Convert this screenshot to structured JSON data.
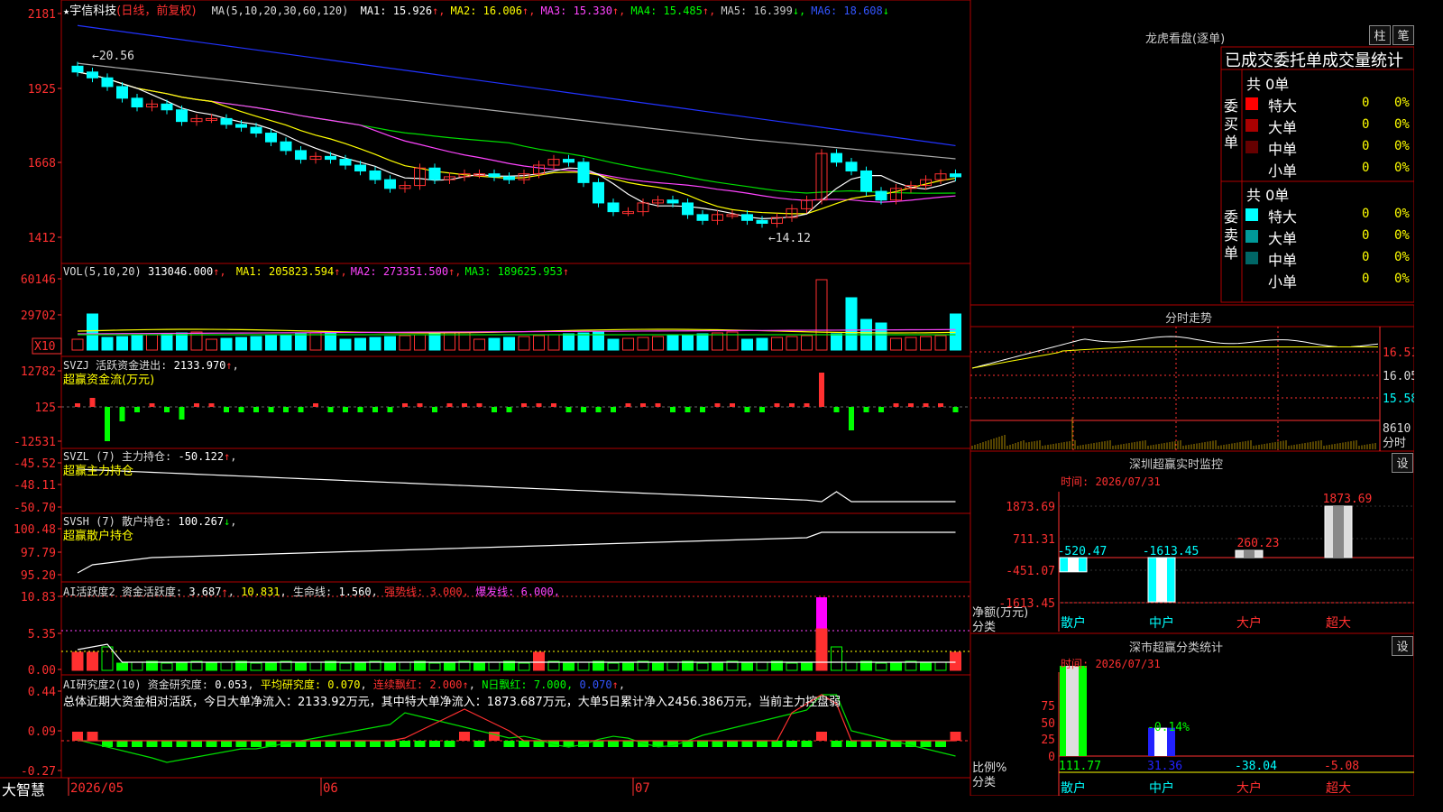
{
  "app": {
    "brand": "大智慧",
    "stock_name": "宇信科技",
    "mode": "(日线，前复权)"
  },
  "kline": {
    "ma_header": "MA(5,10,20,30,60,120)",
    "ma": [
      {
        "label": "MA1:",
        "value": "15.926",
        "arrow": "↑",
        "color": "#ffffff"
      },
      {
        "label": "MA2:",
        "value": "16.006",
        "arrow": "↑",
        "color": "#ffff00"
      },
      {
        "label": "MA3:",
        "value": "15.330",
        "arrow": "↑",
        "color": "#ff44ff"
      },
      {
        "label": "MA4:",
        "value": "15.485",
        "arrow": "↑",
        "color": "#00ff00"
      },
      {
        "label": "MA5:",
        "value": "16.399",
        "arrow": "↓",
        "color": "#c8c8c8"
      },
      {
        "label": "MA6:",
        "value": "18.608",
        "arrow": "↓",
        "color": "#3355ff"
      }
    ],
    "y_ticks": [
      "2181",
      "1925",
      "1668",
      "1412"
    ],
    "high_note": "←20.56",
    "low_note": "←14.12"
  },
  "vol": {
    "header": "VOL(5,10,20)",
    "value": "313046.000",
    "ma": [
      {
        "label": "MA1:",
        "value": "205823.594",
        "color": "#ffff00"
      },
      {
        "label": "MA2:",
        "value": "273351.500",
        "color": "#ff44ff"
      },
      {
        "label": "MA3:",
        "value": "189625.953",
        "color": "#00ff00"
      }
    ],
    "y_ticks": [
      "60146",
      "29702"
    ],
    "unit": "X10"
  },
  "svzj": {
    "header": "SVZJ  活跃资金进出:",
    "value": "2133.970",
    "sub": "超赢资金流(万元)",
    "y_ticks": [
      "12782",
      "125",
      "-12531"
    ]
  },
  "svzl": {
    "header": "SVZL (7) 主力持仓:",
    "value": "-50.122",
    "sub": "超赢主力持仓",
    "y_ticks": [
      "-45.52",
      "-48.11",
      "-50.70"
    ]
  },
  "svsh": {
    "header": "SVSH (7) 散户持仓:",
    "value": "100.267",
    "sub": "超赢散户持仓",
    "y_ticks": [
      "100.48",
      "97.79",
      "95.20"
    ]
  },
  "ai1": {
    "header": "AI活跃度2 资金活跃度:",
    "value": "3.687",
    "v2": "10.831",
    "life_label": "生命线:",
    "life": "1.560",
    "strong": "强势线: 3.000,",
    "burst": "爆发线: 6.000,",
    "y_ticks": [
      "10.83",
      "5.35",
      "0.00"
    ]
  },
  "ai2": {
    "header": "AI研究度2(10) 资金研究度:",
    "v1": "0.053",
    "avg": "平均研究度: 0.070",
    "lian": "连续飘红: 2.000",
    "nday": "N日飘红: 7.000,",
    "last": "0.070",
    "summary": "总体近期大资金相对活跃，今日大单净流入：2133.92万元，其中特大单净流入：1873.687万元，大单5日累计净入2456.386万元，当前主力控盘弱",
    "y_ticks": [
      "0.44",
      "0.09",
      "-0.27"
    ]
  },
  "x_labels": [
    "2026/05",
    "06",
    "07"
  ],
  "dragon": {
    "title": "龙虎看盘(逐单)",
    "btn1": "柱",
    "btn2": "笔",
    "tabs": "已成交委托单成交量统计",
    "buy_total": "共 0单",
    "sell_total": "共 0单",
    "buy_label": "委买单",
    "sell_label": "委卖单",
    "buy_rows": [
      {
        "name": "特大",
        "n": "0",
        "p": "0%",
        "color": "#ff0000"
      },
      {
        "name": "大单",
        "n": "0",
        "p": "0%",
        "color": "#aa0000"
      },
      {
        "name": "中单",
        "n": "0",
        "p": "0%",
        "color": "#660000"
      },
      {
        "name": "小单",
        "n": "0",
        "p": "0%",
        "color": "#000000"
      }
    ],
    "sell_rows": [
      {
        "name": "特大",
        "n": "0",
        "p": "0%",
        "color": "#00ffff"
      },
      {
        "name": "大单",
        "n": "0",
        "p": "0%",
        "color": "#009999"
      },
      {
        "name": "中单",
        "n": "0",
        "p": "0%",
        "color": "#006666"
      },
      {
        "name": "小单",
        "n": "0",
        "p": "0%",
        "color": "#000000"
      }
    ]
  },
  "intraday": {
    "title": "分时走势",
    "prices": [
      "16.51",
      "16.05",
      "15.58"
    ],
    "vol": "8610",
    "vol_unit": "分时"
  },
  "monitor": {
    "title": "深圳超赢实时监控",
    "btn": "设",
    "time": "时间: 2026/07/31",
    "y_ticks": [
      "1873.69",
      "711.31",
      "-451.07",
      "-1613.45"
    ],
    "ylabel": "净额(万元)",
    "xlabel": "分类",
    "categories": [
      "散户",
      "中户",
      "大户",
      "超大"
    ],
    "values": [
      -520.47,
      -1613.45,
      260.23,
      1873.69
    ],
    "labels": [
      "-520.47",
      "-1613.45",
      "260.23",
      "1873.69"
    ]
  },
  "classify": {
    "title": "深市超赢分类统计",
    "btn": "设",
    "time": "时间: 2026/07/31",
    "y_ticks": [
      "75",
      "50",
      "25",
      "0"
    ],
    "ylabel": "比例%",
    "xlabel": "分类",
    "categories": [
      "散户",
      "中户",
      "大户",
      "超大"
    ],
    "values": [
      111.77,
      31.36,
      -38.04,
      -5.08
    ],
    "labels": [
      "111.77",
      "31.36",
      "-38.04",
      "-5.08"
    ],
    "note": "-0.14%"
  },
  "chart_data": {
    "type": "candlestick",
    "title": "宇信科技 (日线，前复权)",
    "x_range": [
      "2026/05",
      "2026/07/31"
    ],
    "ylim": [
      14.12,
      21.81
    ],
    "close": [
      19.8,
      19.6,
      19.3,
      18.9,
      18.6,
      18.7,
      18.5,
      18.1,
      18.2,
      18.2,
      18.0,
      17.9,
      17.7,
      17.4,
      17.1,
      16.8,
      16.9,
      16.8,
      16.6,
      16.4,
      16.1,
      15.8,
      15.9,
      16.5,
      16.1,
      16.2,
      16.3,
      16.3,
      16.2,
      16.1,
      16.3,
      16.6,
      16.8,
      16.7,
      16.0,
      15.3,
      15.0,
      15.0,
      15.3,
      15.4,
      15.3,
      14.9,
      14.7,
      14.9,
      14.9,
      14.7,
      14.6,
      14.8,
      15.1,
      15.4,
      17.0,
      16.7,
      16.4,
      15.7,
      15.4,
      15.8,
      15.9,
      16.1,
      16.3,
      16.2
    ]
  }
}
